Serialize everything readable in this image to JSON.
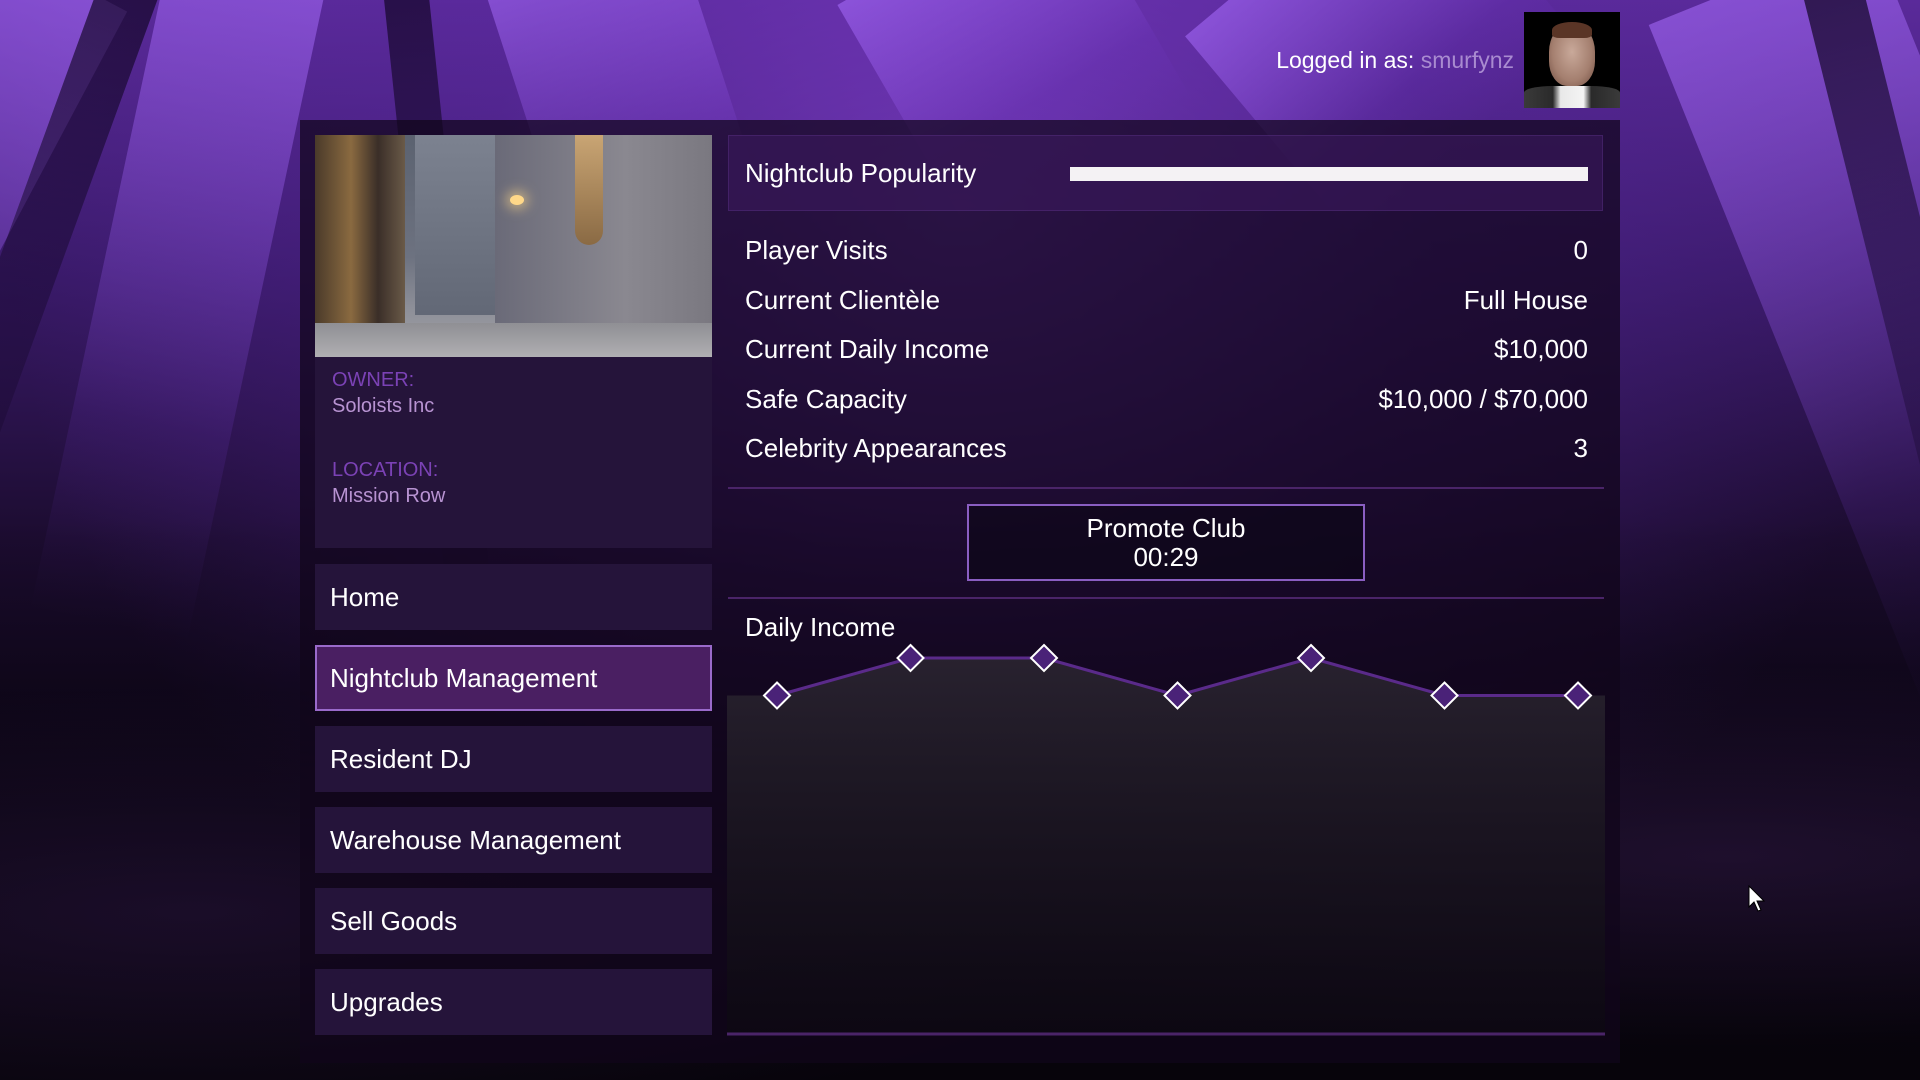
{
  "header": {
    "logged_in_label": "Logged in as:",
    "username": "smurfynz",
    "avatar_icon": "player-portrait"
  },
  "property": {
    "photo": "nightclub-exterior-alley",
    "owner_label": "OWNER:",
    "owner_value": "Soloists Inc",
    "location_label": "LOCATION:",
    "location_value": "Mission Row"
  },
  "nav": {
    "items": [
      {
        "label": "Home",
        "active": false
      },
      {
        "label": "Nightclub Management",
        "active": true
      },
      {
        "label": "Resident DJ",
        "active": false
      },
      {
        "label": "Warehouse Management",
        "active": false
      },
      {
        "label": "Sell Goods",
        "active": false
      },
      {
        "label": "Upgrades",
        "active": false
      }
    ]
  },
  "popularity": {
    "label": "Nightclub Popularity",
    "percent": 100
  },
  "stats": [
    {
      "label": "Player Visits",
      "value": "0"
    },
    {
      "label": "Current Clientèle",
      "value": "Full House"
    },
    {
      "label": "Current Daily Income",
      "value": "$10,000"
    },
    {
      "label": "Safe Capacity",
      "value": "$10,000 / $70,000"
    },
    {
      "label": "Celebrity Appearances",
      "value": "3"
    }
  ],
  "promote": {
    "label": "Promote Club",
    "timer": "00:29"
  },
  "colors": {
    "accent": "#5a2a8a",
    "marker_fill": "#4a2278",
    "marker_stroke": "#ffffff",
    "label_purple": "#7b42b5",
    "value_purple": "#b893d2",
    "panel": "#25143a",
    "active_border": "#9a6acb"
  },
  "chart_data": {
    "type": "line",
    "title": "Daily Income",
    "x": [
      1,
      2,
      3,
      4,
      5,
      6,
      7
    ],
    "series": [
      {
        "name": "Daily Income",
        "values": [
          9000,
          10000,
          10000,
          9000,
          10000,
          9000,
          9000
        ]
      }
    ],
    "xlabel": "",
    "ylabel": "",
    "ylim": [
      0,
      10000
    ],
    "grid": false,
    "legend": "none",
    "area_fill": true,
    "marker": "diamond"
  }
}
